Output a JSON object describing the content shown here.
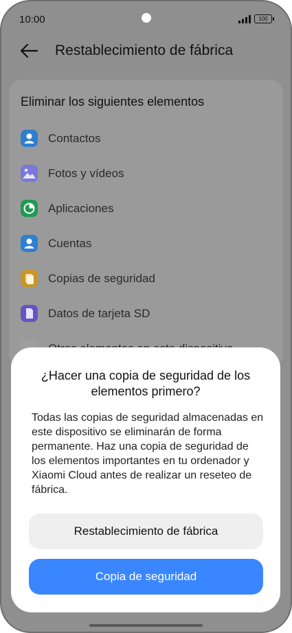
{
  "status_bar": {
    "time": "10:00",
    "battery": "100"
  },
  "header": {
    "title": "Restablecimiento de fábrica"
  },
  "card": {
    "title": "Eliminar los siguientes elementos",
    "items": [
      {
        "label": "Contactos",
        "icon": "contacts-icon",
        "color": "#2f7fd0"
      },
      {
        "label": "Fotos y vídeos",
        "icon": "gallery-icon",
        "color": "#7a78d8"
      },
      {
        "label": "Aplicaciones",
        "icon": "apps-icon",
        "color": "#1f9a52"
      },
      {
        "label": "Cuentas",
        "icon": "account-icon",
        "color": "#2f7fd0"
      },
      {
        "label": "Copias de seguridad",
        "icon": "backup-icon",
        "color": "#c8952a"
      },
      {
        "label": "Datos de tarjeta SD",
        "icon": "sd-card-icon",
        "color": "#6555c2"
      },
      {
        "label": "Otros elementos en este dispositivo",
        "icon": "other-items-icon",
        "color": "#9e9e9e"
      }
    ]
  },
  "dialog": {
    "title": "¿Hacer una copia de seguridad de los elementos primero?",
    "message": "Todas las copias de seguridad almacenadas en este dispositivo se eliminarán de forma permanente. Haz una copia de seguridad de los elementos importantes en tu ordenador y Xiaomi Cloud antes de realizar un reseteo de fábrica.",
    "secondary_button": "Restablecimiento de fábrica",
    "primary_button": "Copia de seguridad"
  }
}
